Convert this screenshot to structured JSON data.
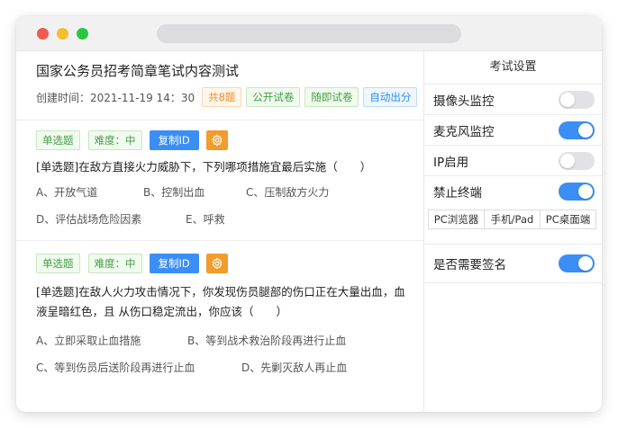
{
  "exam": {
    "title": "国家公务员招考简章笔试内容测试",
    "created_label": "创建时间：2021-11-19  14：30",
    "tags": [
      "共8题",
      "公开试卷",
      "随即试卷",
      "自动出分"
    ]
  },
  "questions": [
    {
      "type_tag": "单选题",
      "difficulty_tag": "难度：中",
      "copy_label": "复制ID",
      "text": "[单选题]在敌方直接火力威胁下，下列哪项措施宜最后实施（　　）",
      "options": [
        "A、开放气道",
        "B、控制出血",
        "C、压制敌方火力",
        "D、评估战场危险因素",
        "E、呼救"
      ]
    },
    {
      "type_tag": "单选题",
      "difficulty_tag": "难度：中",
      "copy_label": "复制ID",
      "text": "[单选题]在敌人火力攻击情况下，你发现伤员腿部的伤口正在大量出血，血液呈暗红色，且 从伤口稳定流出，你应该（　　）",
      "options": [
        "A、立即采取止血措施",
        "B、等到战术救治阶段再进行止血",
        "C、等到伤员后送阶段再进行止血",
        "D、先剿灭敌人再止血"
      ]
    }
  ],
  "settings": {
    "title": "考试设置",
    "camera_label": "摄像头监控",
    "camera_on": false,
    "mic_label": "麦克风监控",
    "mic_on": true,
    "ip_label": "IP启用",
    "ip_on": false,
    "terminal_label": "禁止终端",
    "terminal_on": true,
    "terminals": [
      "PC浏览器",
      "手机/Pad",
      "PC桌面端"
    ],
    "signature_label": "是否需要签名",
    "signature_on": true
  },
  "colors": {
    "accent": "#3a8ef5",
    "gear": "#f29c2b"
  }
}
